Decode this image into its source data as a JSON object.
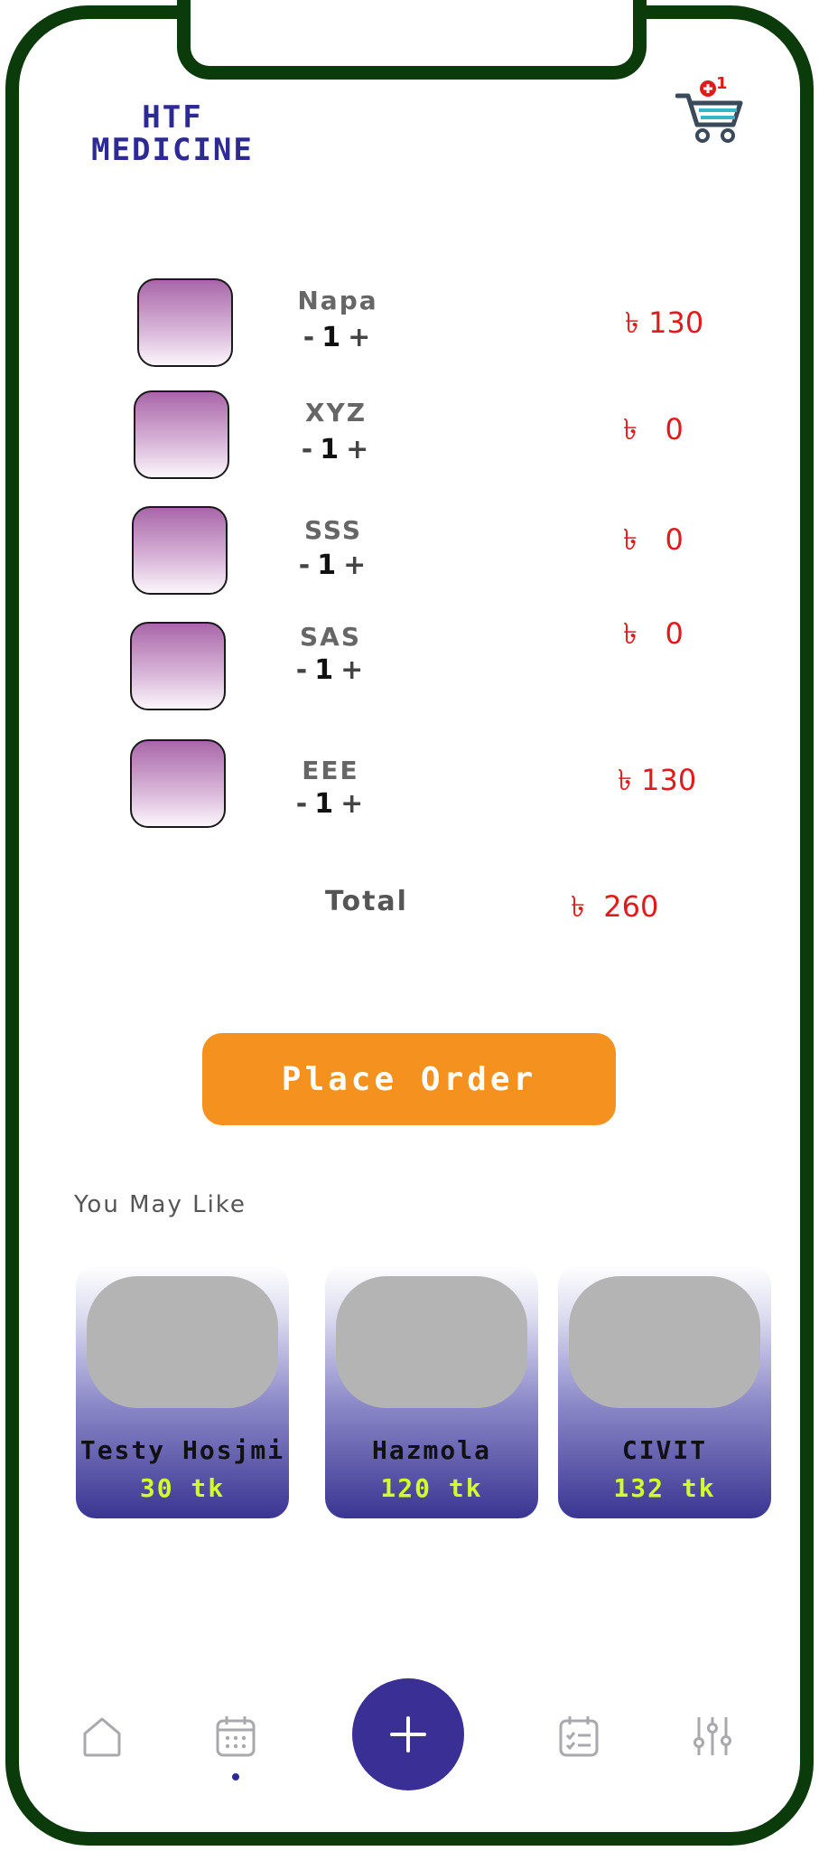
{
  "brand": {
    "line1": "HTF",
    "line2": "MEDICINE"
  },
  "cart": {
    "badge": "1",
    "icon": "cart-icon"
  },
  "cart_items": [
    {
      "name": "Napa",
      "qty": "1",
      "minus": "-",
      "plus": "+",
      "price": "৳ 130"
    },
    {
      "name": "XYZ",
      "qty": "1",
      "minus": "-",
      "plus": "+",
      "price": "৳   0"
    },
    {
      "name": "SSS",
      "qty": "1",
      "minus": "-",
      "plus": "+",
      "price": "৳   0"
    },
    {
      "name": "SAS",
      "qty": "1",
      "minus": "-",
      "plus": "+",
      "price": "৳   0"
    },
    {
      "name": "EEE",
      "qty": "1",
      "minus": "-",
      "plus": "+",
      "price": "৳ 130"
    }
  ],
  "summary": {
    "total_label": "Total",
    "total_price": "৳  260"
  },
  "actions": {
    "place_order": "Place Order"
  },
  "recommendations": {
    "title": "You May Like",
    "items": [
      {
        "name": "Testy Hosjmi",
        "price": "30 tk"
      },
      {
        "name": "Hazmola",
        "price": "120 tk"
      },
      {
        "name": "CIVIT",
        "price": "132 tk"
      }
    ]
  },
  "bottom_nav": {
    "items": [
      "home-icon",
      "calendar-icon",
      "add-icon",
      "checklist-calendar-icon",
      "sliders-icon"
    ],
    "active": "calendar-icon"
  },
  "colors": {
    "frame": "#0b3a0b",
    "brand": "#2e2a94",
    "price": "#e01b1b",
    "button": "#f5921f",
    "fab": "#3a2f94",
    "card_price": "#d3ff2a"
  }
}
